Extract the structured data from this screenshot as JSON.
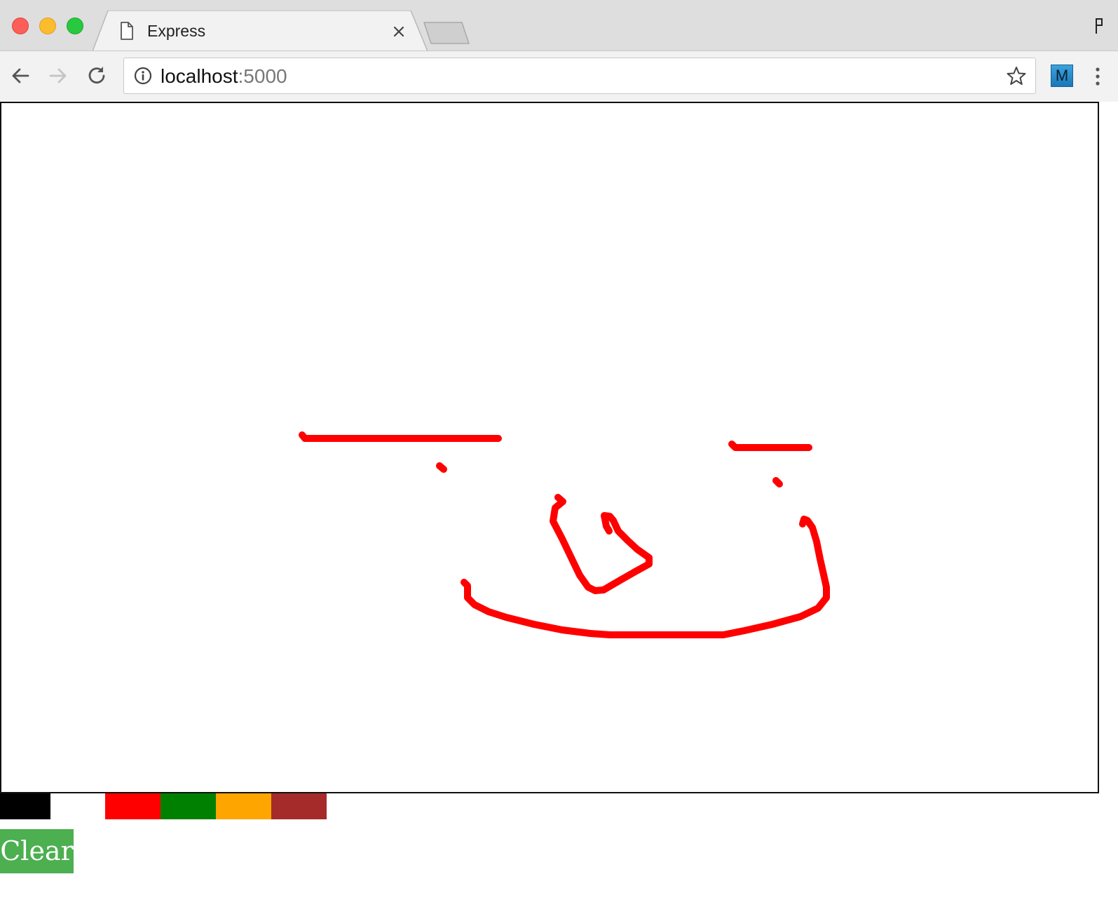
{
  "tab": {
    "title": "Express",
    "icon": "page-icon"
  },
  "address_bar": {
    "host": "localhost",
    "port": ":5000"
  },
  "extension": {
    "label": "M"
  },
  "palette": {
    "colors": [
      "#000000",
      "#ffffff",
      "#ff0000",
      "#008000",
      "#ffa500",
      "#a52a2a"
    ]
  },
  "stroke": {
    "color": "#ff0000"
  },
  "clear_button": {
    "label": "Clear"
  },
  "theme": {
    "clear_button_bg": "#4caf50",
    "window_close": "#fc5f57",
    "window_minimize": "#fdbc2e",
    "window_maximize": "#28c840"
  }
}
